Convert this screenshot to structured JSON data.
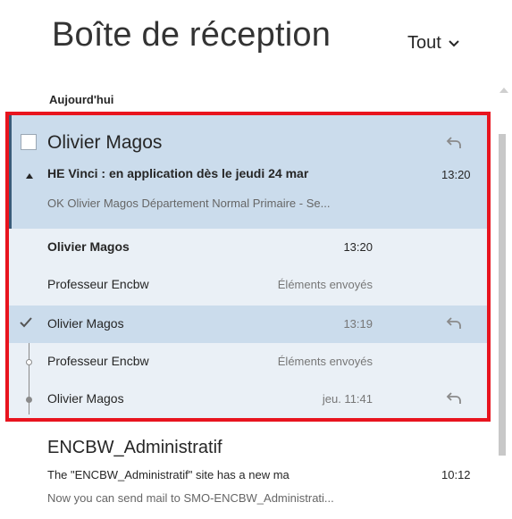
{
  "header": {
    "title": "Boîte de réception",
    "filter_label": "Tout"
  },
  "group_label": "Aujourd'hui",
  "thread": {
    "sender": "Olivier Magos",
    "subject": "HE Vinci : en application dès le jeudi 24 mar",
    "time": "13:20",
    "preview": "OK  Olivier Magos Département Normal Primaire - Se...",
    "messages": [
      {
        "name": "Olivier Magos",
        "meta": "13:20"
      },
      {
        "name": "Professeur Encbw",
        "meta": "Éléments envoyés"
      },
      {
        "name": "Olivier Magos",
        "meta": "13:19"
      },
      {
        "name": "Professeur Encbw",
        "meta": "Éléments envoyés"
      },
      {
        "name": "Olivier Magos",
        "meta": "jeu. 11:41"
      }
    ]
  },
  "next_message": {
    "sender": "ENCBW_Administratif",
    "subject": "The \"ENCBW_Administratif\" site has a new ma",
    "time": "10:12",
    "preview": "Now you can send mail to SMO-ENCBW_Administrati..."
  },
  "colors": {
    "selected_bg": "#cbdcec",
    "thread_bg": "#eaf0f6",
    "highlight_frame": "#e8141e",
    "accent": "#3a5c7a"
  },
  "icons": [
    "chevron-down-icon",
    "reply-icon",
    "checkmark-icon",
    "collapse-caret-icon",
    "scroll-up-icon"
  ]
}
